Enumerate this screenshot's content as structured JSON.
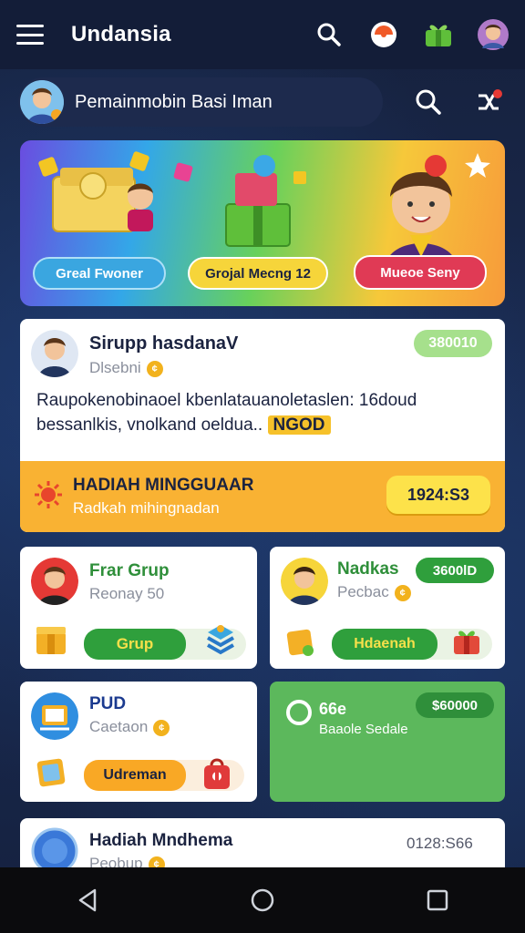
{
  "app_bar": {
    "title": "Undansia",
    "icons": [
      "menu-icon",
      "search-icon",
      "notification-chat-icon",
      "gift-icon",
      "profile-avatar"
    ]
  },
  "search_bar": {
    "text": "Pemainmobin Basi Iman",
    "icons": [
      "search-icon",
      "shuffle-icon"
    ]
  },
  "banner": {
    "buttons": [
      "Greal Fwoner",
      "Grojal Mecng 12",
      "Mueoe Seny"
    ]
  },
  "group_card": {
    "title": "Sirupp hasdanaV",
    "subtitle": "Dlsebni",
    "badge": "380010",
    "description": "Raupokenobinaoel kbenlatauanoletaslen: 16doud bessanlkis, vnolkand oeldua..",
    "highlight": "NGOD",
    "footer_title": "HADIAH MINGGUAAR",
    "footer_subtitle": "Radkah mihingnadan",
    "footer_amount": "1924:S3"
  },
  "tile_1": {
    "title": "Frar Grup",
    "subtitle": "Reonay 50",
    "action": "Grup"
  },
  "tile_2": {
    "title": "Nadkas",
    "subtitle": "Pecbac",
    "badge": "3600lD",
    "action": "Hdaenah"
  },
  "tile_3": {
    "title": "PUD",
    "subtitle": "Caetaon",
    "action": "Udreman"
  },
  "tile_4": {
    "title": "66e",
    "subtitle": "Baaole Sedale",
    "badge": "$60000"
  },
  "bottom_card": {
    "title": "Hadiah Mndhema",
    "subtitle": "Peobup",
    "amount": "0128:S66"
  },
  "colors": {
    "background": "#14213f",
    "green": "#2f9f3c",
    "orange": "#f9a825",
    "yellow_btn": "#f6c12a",
    "red_btn": "#e03a55",
    "tile_green": "#5cb85c"
  }
}
